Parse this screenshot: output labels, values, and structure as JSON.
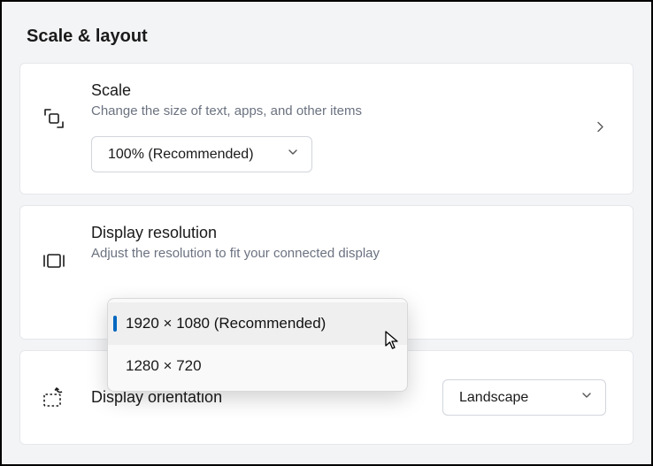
{
  "sectionHeader": "Scale & layout",
  "scale": {
    "title": "Scale",
    "subtitle": "Change the size of text, apps, and other items",
    "value": "100% (Recommended)"
  },
  "resolution": {
    "title": "Display resolution",
    "subtitle": "Adjust the resolution to fit your connected display",
    "options": {
      "opt0": "1920 × 1080 (Recommended)",
      "opt1": "1280 × 720"
    }
  },
  "orientation": {
    "title": "Display orientation",
    "value": "Landscape"
  }
}
